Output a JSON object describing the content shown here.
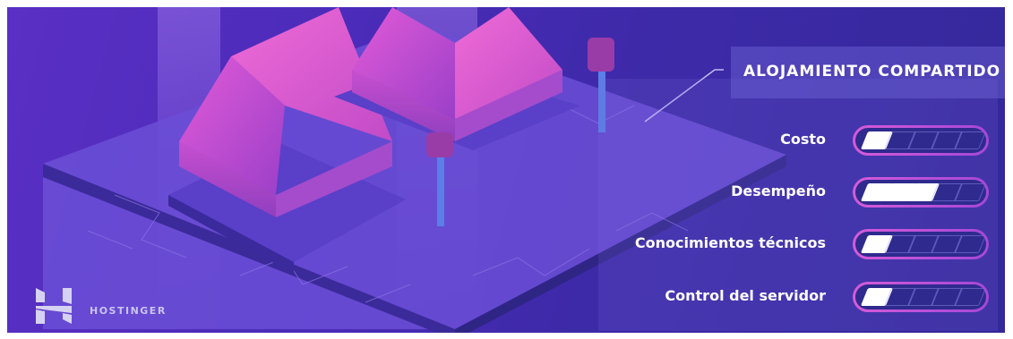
{
  "banner": {
    "heading": "ALOJAMIENTO COMPARTIDO",
    "brand": "HOSTINGER",
    "ratings": [
      {
        "label": "Costo",
        "level": 1,
        "max": 5
      },
      {
        "label": "Desempeño",
        "level": 3,
        "max": 5
      },
      {
        "label": "Conocimientos técnicos",
        "level": 1,
        "max": 5
      },
      {
        "label": "Control del servidor",
        "level": 1,
        "max": 5
      }
    ]
  },
  "colors": {
    "background": "#4a2bb8",
    "accent": "#d55bd8",
    "meter_track": "#2e2a8e",
    "house_roof": "#c84fd0",
    "house_wall": "#b94ab8"
  },
  "icons": [
    "hostinger-logo-icon",
    "mailbox-icon"
  ]
}
